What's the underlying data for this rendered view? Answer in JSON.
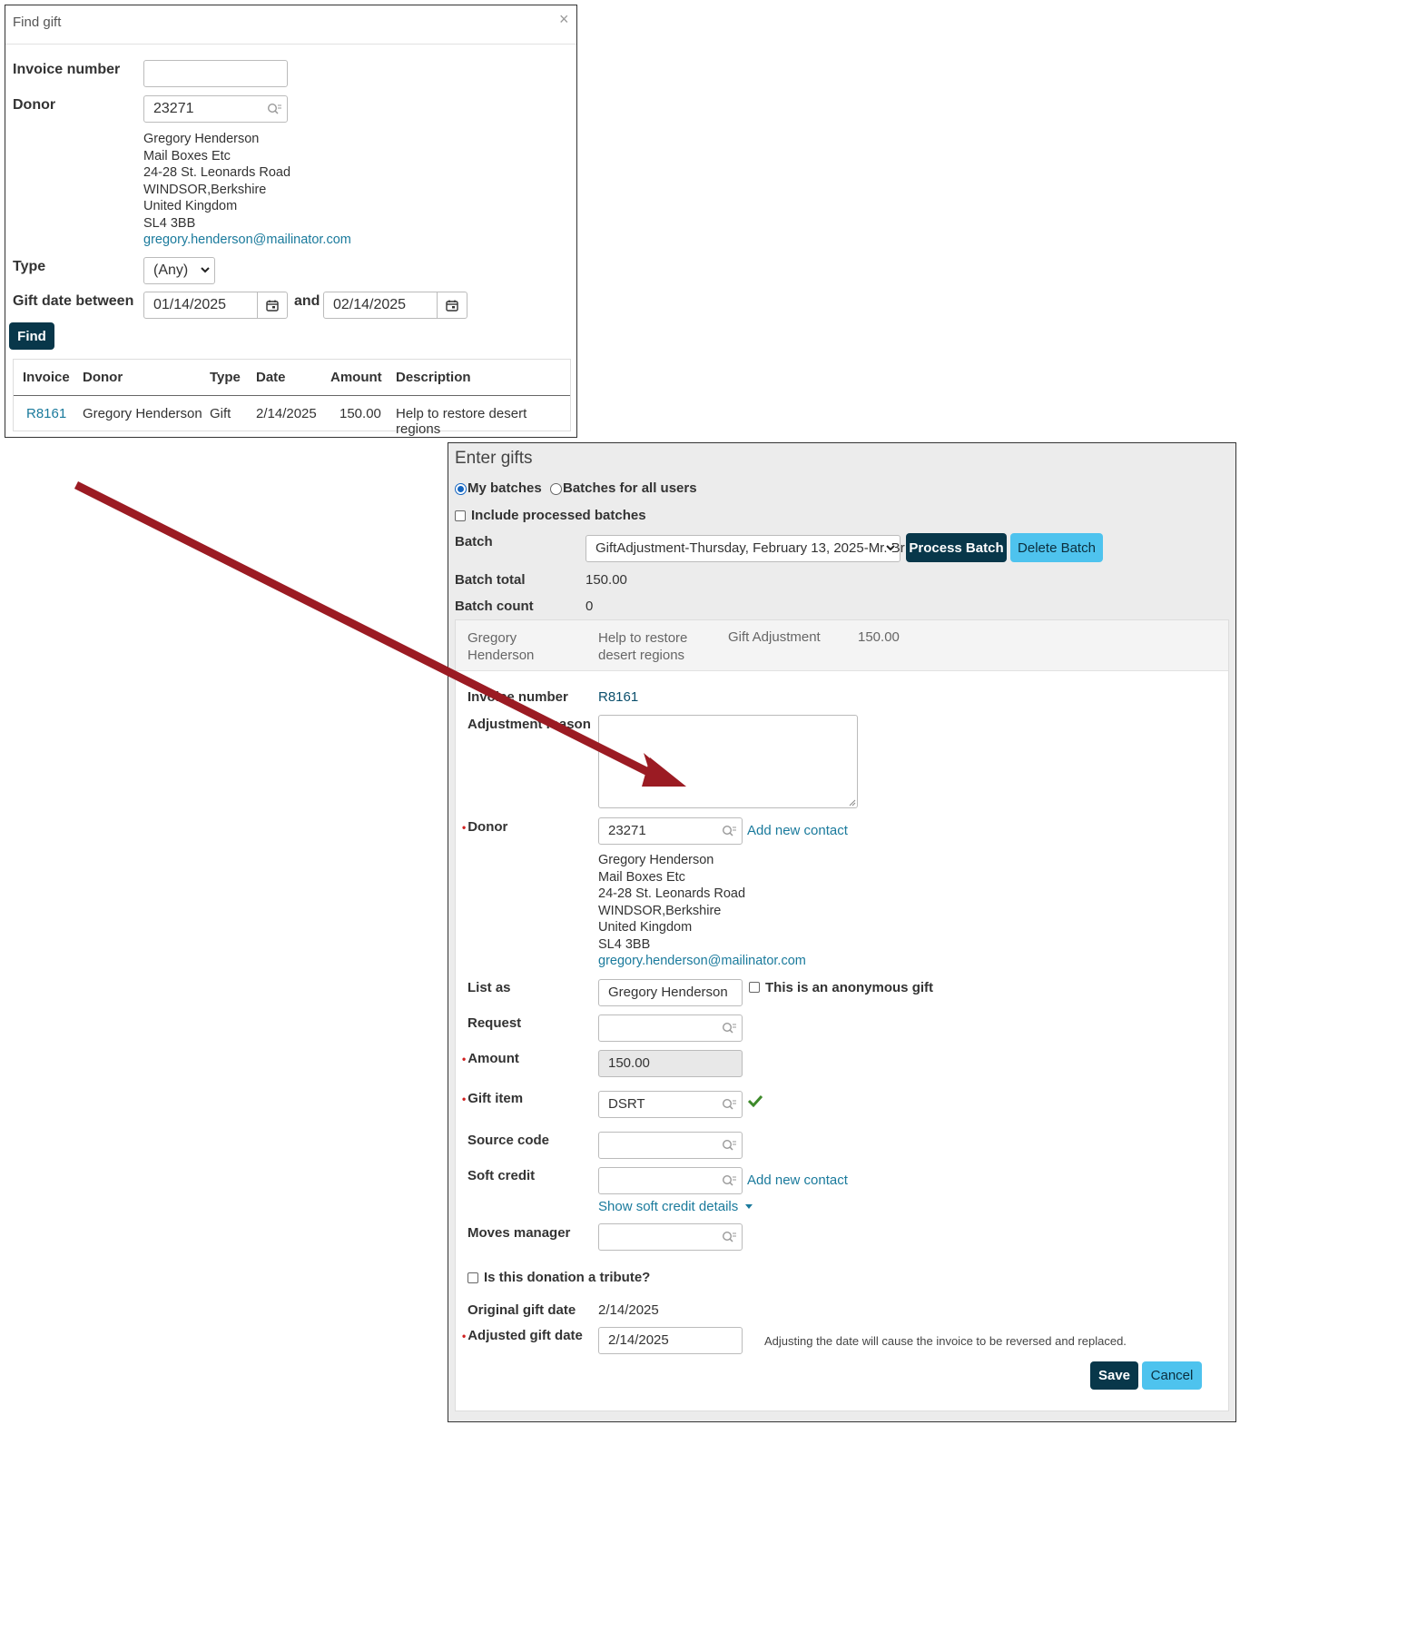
{
  "find_gift": {
    "title": "Find gift",
    "close_glyph": "×",
    "invoice_label": "Invoice number",
    "invoice_value": "",
    "donor_label": "Donor",
    "donor_value": "23271",
    "address": [
      "Gregory Henderson",
      "Mail Boxes Etc",
      "24-28 St. Leonards Road",
      "WINDSOR,Berkshire",
      "United Kingdom",
      "SL4 3BB"
    ],
    "email": "gregory.henderson@mailinator.com",
    "type_label": "Type",
    "type_value": "(Any)",
    "date_label": "Gift date between",
    "date_from": "01/14/2025",
    "and_label": "and",
    "date_to": "02/14/2025",
    "find_button": "Find",
    "table": {
      "headers": [
        "Invoice",
        "Donor",
        "Type",
        "Date",
        "Amount",
        "Description"
      ],
      "rows": [
        [
          "R8161",
          "Gregory Henderson",
          "Gift",
          "2/14/2025",
          "150.00",
          "Help to restore desert regions"
        ]
      ]
    }
  },
  "enter_gifts": {
    "title": "Enter gifts",
    "my_batches": "My batches",
    "all_batches": "Batches for all users",
    "include_processed": "Include processed batches",
    "batch_label": "Batch",
    "batch_value": "GiftAdjustment-Thursday, February 13, 2025-Mr. Br",
    "process_button": "Process Batch",
    "delete_button": "Delete Batch",
    "batch_total_label": "Batch total",
    "batch_total": "150.00",
    "batch_count_label": "Batch count",
    "batch_count": "0",
    "summary": {
      "donor": "Gregory Henderson",
      "description": "Help to restore desert regions",
      "type": "Gift Adjustment",
      "amount": "150.00"
    },
    "invoice_label": "Invoice number",
    "invoice_value": "R8161",
    "adj_reason_label": "Adjustment reason",
    "donor_label": "Donor",
    "donor_value": "23271",
    "add_new_contact": "Add new contact",
    "address": [
      "Gregory Henderson",
      "Mail Boxes Etc",
      "24-28 St. Leonards Road",
      "WINDSOR,Berkshire",
      "United Kingdom",
      "SL4 3BB"
    ],
    "email": "gregory.henderson@mailinator.com",
    "list_as_label": "List as",
    "list_as_value": "Gregory Henderson",
    "anonymous_label": "This is an anonymous gift",
    "request_label": "Request",
    "amount_label": "Amount",
    "amount_value": "150.00",
    "gift_item_label": "Gift item",
    "gift_item_value": "DSRT",
    "source_code_label": "Source code",
    "soft_credit_label": "Soft credit",
    "add_new_contact_2": "Add new contact",
    "show_soft_credit": "Show soft credit details",
    "moves_manager_label": "Moves manager",
    "tribute_label": "Is this donation a tribute?",
    "orig_date_label": "Original gift date",
    "orig_date_value": "2/14/2025",
    "adj_date_label": "Adjusted gift date",
    "adj_date_value": "2/14/2025",
    "adj_date_note": "Adjusting the date will cause the invoice to be reversed and replaced.",
    "save_button": "Save",
    "cancel_button": "Cancel"
  },
  "colors": {
    "accent_dark": "#08374a",
    "accent_light": "#4ec3ee",
    "link": "#1a7a9c",
    "arrow": "#9b1b23",
    "check": "#3d8a2a"
  }
}
